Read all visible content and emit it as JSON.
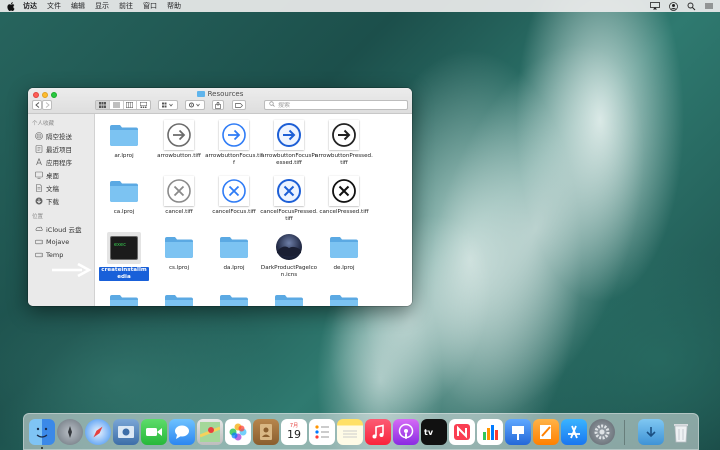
{
  "menubar": {
    "items": [
      "访达",
      "文件",
      "编辑",
      "显示",
      "前往",
      "窗口",
      "帮助"
    ]
  },
  "window": {
    "title": "Resources",
    "search_placeholder": "搜索"
  },
  "sidebar": {
    "sections": [
      {
        "label": "个人收藏",
        "items": [
          {
            "label": "隔空投送",
            "icon": "airdrop-icon"
          },
          {
            "label": "最近项目",
            "icon": "recents-icon"
          },
          {
            "label": "应用程序",
            "icon": "applications-icon"
          },
          {
            "label": "桌面",
            "icon": "desktop-icon"
          },
          {
            "label": "文稿",
            "icon": "documents-icon"
          },
          {
            "label": "下载",
            "icon": "downloads-icon"
          }
        ]
      },
      {
        "label": "位置",
        "items": [
          {
            "label": "iCloud 云盘",
            "icon": "icloud-icon"
          },
          {
            "label": "Mojave",
            "icon": "disk-icon"
          },
          {
            "label": "Temp",
            "icon": "disk-icon"
          }
        ]
      }
    ]
  },
  "files": {
    "row1": [
      {
        "label": "ar.lproj",
        "icon": "folder-icon"
      },
      {
        "label": "arrowbutton.tiff",
        "icon": "arrow-circle-icon"
      },
      {
        "label": "arrowbuttonFocus.tiff",
        "icon": "arrow-circle-focus-icon"
      },
      {
        "label": "arrowbuttonFocusPressed.tiff",
        "icon": "arrow-circle-focus-pressed-icon"
      },
      {
        "label": "arrowbuttonPressed.tiff",
        "icon": "arrow-circle-pressed-icon"
      }
    ],
    "row2": [
      {
        "label": "ca.lproj",
        "icon": "folder-icon"
      },
      {
        "label": "cancel.tiff",
        "icon": "cancel-circle-icon"
      },
      {
        "label": "cancelFocus.tiff",
        "icon": "cancel-focus-icon"
      },
      {
        "label": "cancelFocusPressed.tiff",
        "icon": "cancel-focus-pressed-icon"
      },
      {
        "label": "cancelPressed.tiff",
        "icon": "cancel-pressed-icon"
      }
    ],
    "row3": [
      {
        "label": "createinstallmedia",
        "icon": "terminal-exec-icon",
        "selected": true
      },
      {
        "label": "cs.lproj",
        "icon": "folder-icon"
      },
      {
        "label": "da.lproj",
        "icon": "folder-icon"
      },
      {
        "label": "DarkProductPageIcon.icns",
        "icon": "mojave-icon"
      },
      {
        "label": "de.lproj",
        "icon": "folder-icon"
      }
    ]
  },
  "dock": {
    "calendar_month": "7月",
    "calendar_day": "19"
  },
  "colors": {
    "selection": "#1960d9",
    "folder": "#5fb4ec",
    "focus_blue": "#2f7cf6"
  }
}
